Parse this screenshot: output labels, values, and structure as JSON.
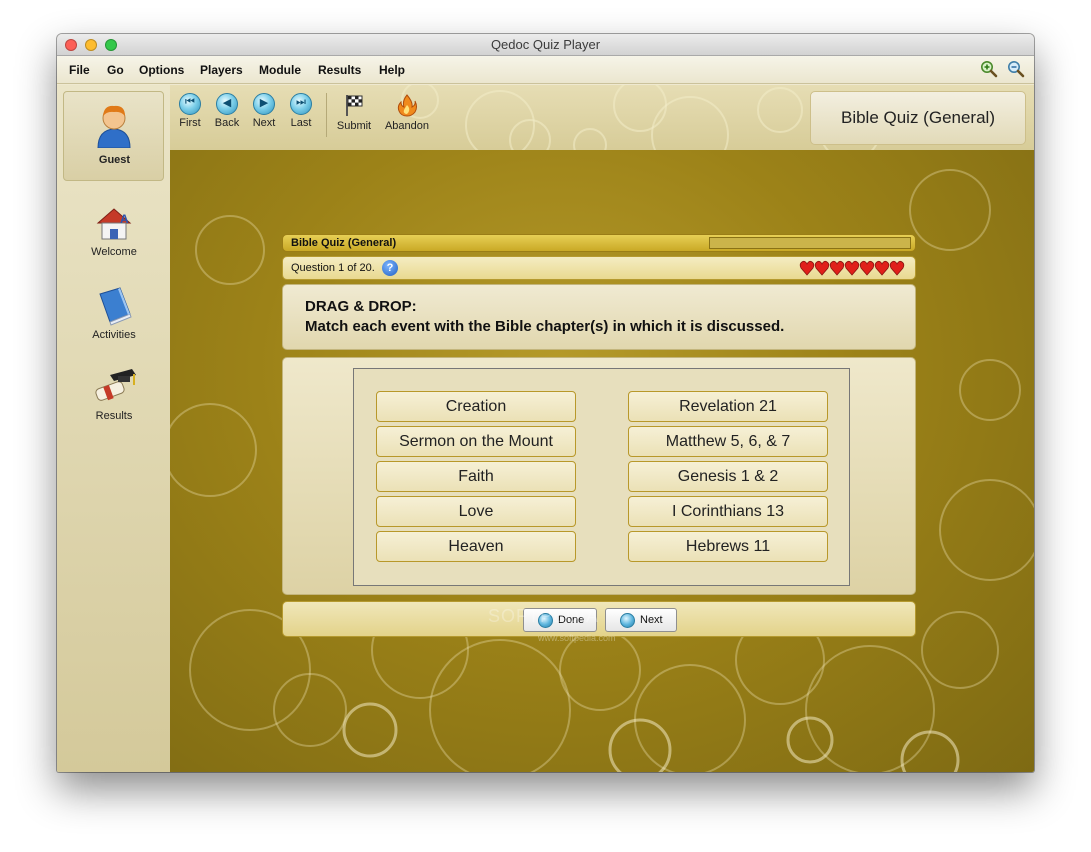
{
  "window": {
    "title": "Qedoc Quiz Player"
  },
  "menu": [
    "File",
    "Go",
    "Options",
    "Players",
    "Module",
    "Results",
    "Help"
  ],
  "zoom": {
    "in_icon": "zoom-in-icon",
    "out_icon": "zoom-out-icon"
  },
  "sidebar": {
    "user": "Guest",
    "items": [
      {
        "label": "Welcome",
        "icon": "home-icon"
      },
      {
        "label": "Activities",
        "icon": "book-icon"
      },
      {
        "label": "Results",
        "icon": "graduation-cap-icon"
      }
    ]
  },
  "toolbar": {
    "first": "First",
    "back": "Back",
    "next": "Next",
    "last": "Last",
    "submit": "Submit",
    "abandon": "Abandon"
  },
  "quiz_title": "Bible Quiz (General)",
  "quiz": {
    "header": "Bible Quiz (General)",
    "question_status": "Question 1 of 20.",
    "lives": 7,
    "instruction_line1": "DRAG & DROP:",
    "instruction_line2": "Match each event with the Bible chapter(s) in which it is discussed.",
    "left_items": [
      "Creation",
      "Sermon on the Mount",
      "Faith",
      "Love",
      "Heaven"
    ],
    "right_items": [
      "Revelation 21",
      "Matthew 5, 6, & 7",
      "Genesis 1 & 2",
      "I Corinthians 13",
      "Hebrews 11"
    ],
    "done_label": "Done",
    "next_label": "Next"
  },
  "watermark": {
    "main": "SOFTPEDIA",
    "sub": "www.softpedia.com"
  },
  "colors": {
    "accent_gold": "#c9a925",
    "heart_red": "#e0201a"
  }
}
